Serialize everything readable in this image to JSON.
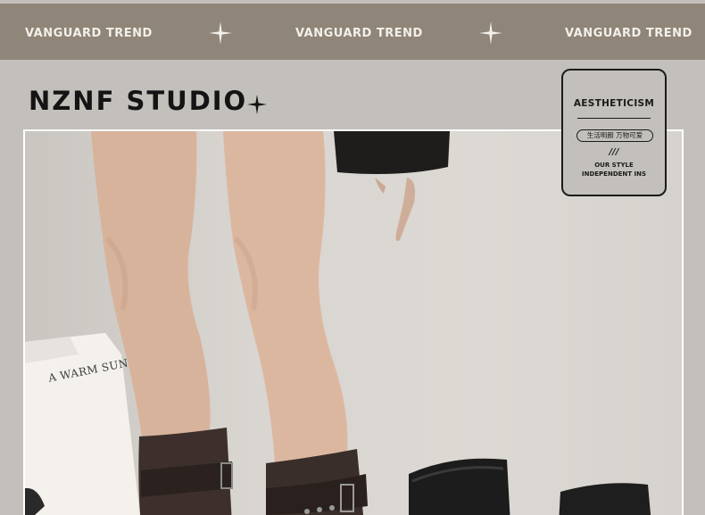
{
  "banner": {
    "items": [
      "VANGUARD TREND",
      "VANGUARD TREND",
      "VANGUARD TREND"
    ],
    "color": "#8f8578"
  },
  "header": {
    "title": "NZNF STUDIO"
  },
  "badge": {
    "title": "AESTHETICISM",
    "pill_text": "生活明朗 万物可爱",
    "slash": "///",
    "line1": "OUR STYLE",
    "line2": "INDEPENDENT INS"
  },
  "photo": {
    "bag_text": "A WARM SUN"
  },
  "colors": {
    "background": "#c3c0bb",
    "banner": "#8f8578",
    "ink": "#141414"
  }
}
